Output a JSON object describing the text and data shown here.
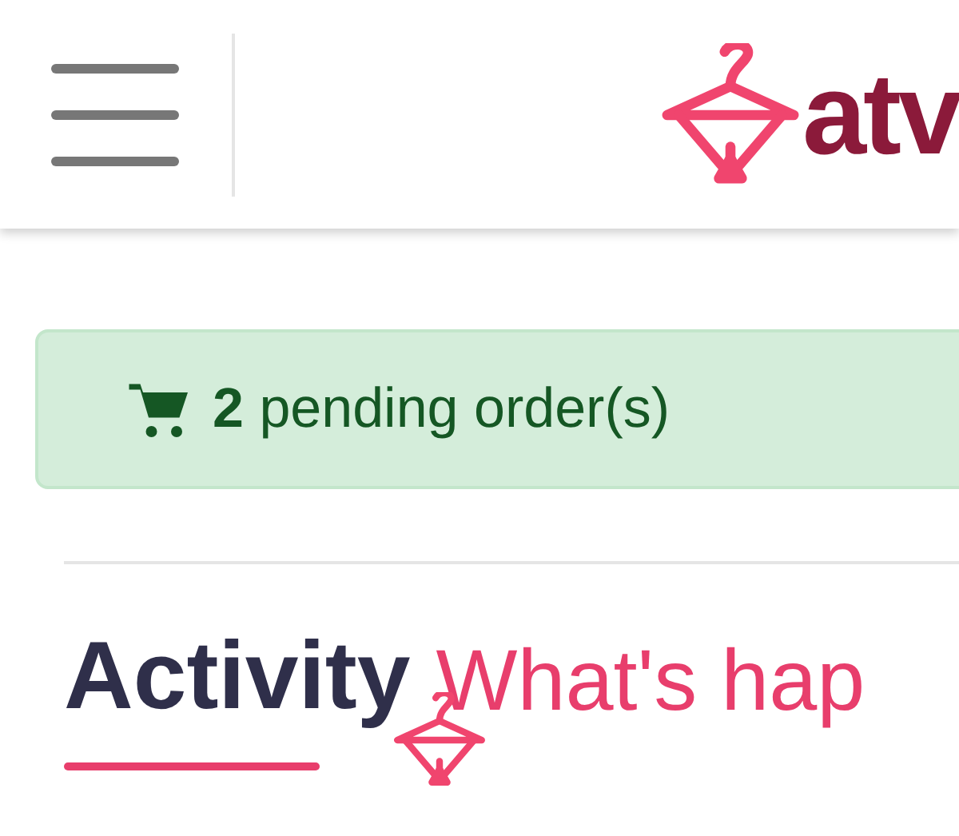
{
  "header": {
    "logo_text": "atv"
  },
  "alert": {
    "text": "**2** pending order(s)"
  },
  "section": {
    "title": "Activity",
    "subtitle": "What's hap"
  }
}
